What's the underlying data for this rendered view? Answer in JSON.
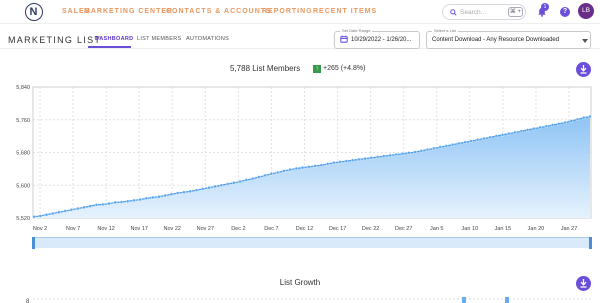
{
  "topbar": {
    "logo_letter": "N",
    "nav": [
      "SALES",
      "MARKETING CENTER",
      "CONTACTS & ACCOUNTS",
      "REPORTING",
      "RECENT ITEMS"
    ],
    "search_placeholder": "Search...",
    "search_shortcut": "⌘ +",
    "notification_count": "1",
    "help_label": "?",
    "avatar_initials": "LB"
  },
  "page": {
    "title": "MARKETING LIST",
    "tabs": [
      "DASHBOARD",
      "LIST MEMBERS",
      "AUTOMATIONS"
    ],
    "active_tab": "DASHBOARD"
  },
  "filters": {
    "date_label": "Set Date Range",
    "date_value": "10/29/2022 - 1/26/20...",
    "list_label": "Select a List",
    "list_value": "Content Download - Any Resource Downloaded"
  },
  "summary": {
    "members_text": "5,788 List Members",
    "up_symbol": "↑",
    "change_text": "+265  (+4.8%)"
  },
  "colors": {
    "accent": "#6b4fd8",
    "nav_orange": "#e8975f",
    "line_blue": "#4a9be8",
    "area_top": "#8ec4f5",
    "area_bottom": "#e6f2fd",
    "gain_green": "#3a9a4a"
  },
  "chart_data": {
    "type": "area",
    "title": "5,788 List Members",
    "x_tick_labels": [
      "Nov 2",
      "Nov 7",
      "Nov 12",
      "Nov 17",
      "Nov 22",
      "Nov 27",
      "Dec 2",
      "Dec 7",
      "Dec 12",
      "Dec 17",
      "Dec 22",
      "Dec 27",
      "Jan 5",
      "Jan 10",
      "Jan 15",
      "Jan 20",
      "Jan 27"
    ],
    "y_tick_labels": [
      "5,840",
      "5,760",
      "5,680",
      "5,600",
      "5,520"
    ],
    "ylim": [
      5520,
      5840
    ],
    "grid": true,
    "x": [
      "Oct 29",
      "Oct 30",
      "Oct 31",
      "Nov 1",
      "Nov 2",
      "Nov 3",
      "Nov 4",
      "Nov 5",
      "Nov 6",
      "Nov 7",
      "Nov 8",
      "Nov 9",
      "Nov 10",
      "Nov 11",
      "Nov 12",
      "Nov 13",
      "Nov 14",
      "Nov 15",
      "Nov 16",
      "Nov 17",
      "Nov 18",
      "Nov 19",
      "Nov 20",
      "Nov 21",
      "Nov 22",
      "Nov 23",
      "Nov 24",
      "Nov 25",
      "Nov 26",
      "Nov 27",
      "Nov 28",
      "Nov 29",
      "Nov 30",
      "Dec 1",
      "Dec 2",
      "Dec 3",
      "Dec 4",
      "Dec 5",
      "Dec 6",
      "Dec 7",
      "Dec 8",
      "Dec 9",
      "Dec 10",
      "Dec 11",
      "Dec 12",
      "Dec 13",
      "Dec 14",
      "Dec 15",
      "Dec 16",
      "Dec 17",
      "Dec 18",
      "Dec 19",
      "Dec 20",
      "Dec 21",
      "Dec 22",
      "Dec 23",
      "Dec 24",
      "Dec 25",
      "Dec 26",
      "Dec 27",
      "Dec 28",
      "Dec 29",
      "Dec 30",
      "Dec 31",
      "Jan 1",
      "Jan 2",
      "Jan 3",
      "Jan 4",
      "Jan 5",
      "Jan 6",
      "Jan 7",
      "Jan 8",
      "Jan 9",
      "Jan 10",
      "Jan 11",
      "Jan 12",
      "Jan 13",
      "Jan 14",
      "Jan 15",
      "Jan 16",
      "Jan 17",
      "Jan 18",
      "Jan 19",
      "Jan 20",
      "Jan 21",
      "Jan 22",
      "Jan 23",
      "Jan 24",
      "Jan 25",
      "Jan 26"
    ],
    "series": [
      {
        "values": [
          5523,
          5525,
          5528,
          5531,
          5534,
          5537,
          5540,
          5543,
          5546,
          5549,
          5552,
          5553,
          5555,
          5558,
          5559,
          5561,
          5563,
          5565,
          5568,
          5570,
          5572,
          5575,
          5578,
          5581,
          5583,
          5585,
          5588,
          5591,
          5594,
          5597,
          5600,
          5603,
          5606,
          5609,
          5613,
          5616,
          5620,
          5624,
          5628,
          5631,
          5635,
          5638,
          5641,
          5643,
          5645,
          5647,
          5649,
          5652,
          5655,
          5657,
          5659,
          5661,
          5663,
          5665,
          5667,
          5669,
          5671,
          5673,
          5675,
          5677,
          5679,
          5681,
          5684,
          5687,
          5690,
          5693,
          5696,
          5699,
          5702,
          5705,
          5708,
          5711,
          5714,
          5717,
          5720,
          5723,
          5726,
          5729,
          5732,
          5735,
          5738,
          5741,
          5744,
          5747,
          5750,
          5753,
          5757,
          5761,
          5765,
          5768
        ]
      }
    ]
  },
  "growth": {
    "title": "List Growth",
    "y_first_label": "8"
  }
}
